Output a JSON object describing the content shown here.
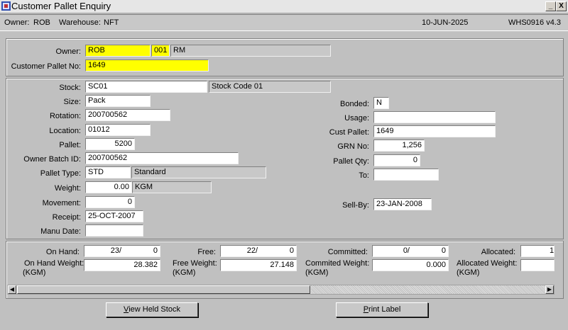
{
  "window": {
    "title": "Customer Pallet Enquiry",
    "minimize": "_",
    "close": "X"
  },
  "infobar": {
    "owner_label": "Owner:",
    "owner": "ROB",
    "warehouse_label": "Warehouse:",
    "warehouse": "NFT",
    "date": "10-JUN-2025",
    "version": "WHS0916  v4.3"
  },
  "header": {
    "owner_label": "Owner:",
    "owner_code": "ROB",
    "owner_num": "001",
    "owner_name": "RM",
    "pallet_label": "Customer Pallet No:",
    "pallet_no": "1649"
  },
  "details": {
    "stock_label": "Stock:",
    "stock": "SC01",
    "stock_desc": "Stock Code 01",
    "size_label": "Size:",
    "size": "Pack",
    "rotation_label": "Rotation:",
    "rotation": "200700562",
    "location_label": "Location:",
    "location": "01012",
    "pallet_label": "Pallet:",
    "pallet": "5200",
    "batch_label": "Owner Batch ID:",
    "batch": "200700562",
    "type_label": "Pallet Type:",
    "type_code": "STD",
    "type_desc": "Standard",
    "weight_label": "Weight:",
    "weight": "0.00",
    "weight_unit": "KGM",
    "movement_label": "Movement:",
    "movement": "0",
    "receipt_label": "Receipt:",
    "receipt": "25-OCT-2007",
    "manu_label": "Manu Date:",
    "manu": "",
    "bonded_label": "Bonded:",
    "bonded": "N",
    "usage_label": "Usage:",
    "usage": "",
    "cust_pallet_label": "Cust Pallet:",
    "cust_pallet": "1649",
    "grn_label": "GRN No:",
    "grn": "1,256",
    "pallet_qty_label": "Pallet Qty:",
    "pallet_qty": "0",
    "to_label": "To:",
    "to": "",
    "sellby_label": "Sell-By:",
    "sellby": "23-JAN-2008"
  },
  "totals": {
    "onhand_label": "On Hand:",
    "onhand_a": "23/",
    "onhand_b": "0",
    "free_label": "Free:",
    "free_a": "22/",
    "free_b": "0",
    "committed_label": "Committed:",
    "committed_a": "0/",
    "committed_b": "0",
    "allocated_label": "Allocated:",
    "allocated_a": "1",
    "onhand_w_label1": "On Hand Weight:",
    "onhand_w_label2": "(KGM)",
    "onhand_w": "28.382",
    "free_w_label1": "Free Weight:",
    "free_w_label2": "(KGM)",
    "free_w": "27.148",
    "committed_w_label1": "Commited Weight:",
    "committed_w_label2": "(KGM)",
    "committed_w": "0.000",
    "allocated_w_label1": "Allocated Weight:",
    "allocated_w_label2": "(KGM)",
    "allocated_w": ""
  },
  "buttons": {
    "view_held_first": "V",
    "view_held_rest": "iew Held Stock",
    "print_first": "P",
    "print_rest": "rint Label"
  }
}
